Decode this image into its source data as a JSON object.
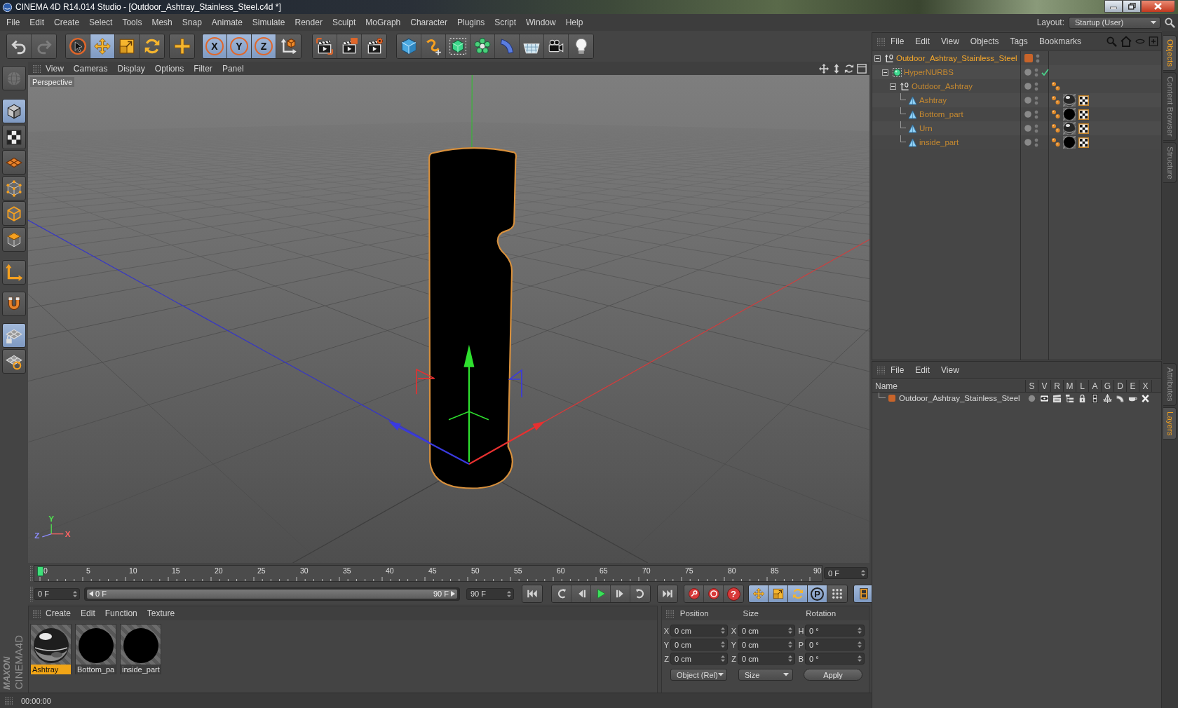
{
  "window": {
    "title": "CINEMA 4D R14.014 Studio - [Outdoor_Ashtray_Stainless_Steel.c4d *]"
  },
  "menu": [
    "File",
    "Edit",
    "Create",
    "Select",
    "Tools",
    "Mesh",
    "Snap",
    "Animate",
    "Simulate",
    "Render",
    "Sculpt",
    "MoGraph",
    "Character",
    "Plugins",
    "Script",
    "Window",
    "Help"
  ],
  "layout": {
    "label": "Layout:",
    "value": "Startup (User)"
  },
  "toolbar": {
    "groups": [
      {
        "buttons": [
          {
            "selected": false,
            "disabled": false
          },
          {
            "selected": false,
            "disabled": true
          }
        ]
      },
      {
        "buttons": [
          {
            "selected": false
          },
          {
            "selected": true
          },
          {
            "selected": false
          },
          {
            "selected": false
          }
        ]
      },
      {
        "buttons": [
          {
            "selected": false
          }
        ]
      },
      {
        "buttons": [
          {
            "label": "X",
            "selected": true
          },
          {
            "label": "Y",
            "selected": true
          },
          {
            "label": "Z",
            "selected": true
          },
          {
            "selected": false
          }
        ]
      },
      {
        "buttons": [
          {
            "selected": false
          },
          {
            "selected": false
          },
          {
            "selected": false
          }
        ]
      },
      {
        "buttons": [
          {
            "selected": false
          },
          {
            "selected": false
          },
          {
            "selected": false
          },
          {
            "selected": false
          },
          {
            "selected": false
          },
          {
            "selected": false
          },
          {
            "selected": false
          },
          {
            "selected": false
          }
        ]
      }
    ]
  },
  "left_tools": [
    {
      "selected": false,
      "disabled": true
    },
    {
      "selected": true,
      "disabled": false
    },
    {
      "selected": false,
      "disabled": false
    },
    {
      "selected": false,
      "disabled": false
    },
    {
      "selected": false,
      "disabled": false
    },
    {
      "selected": false,
      "disabled": false
    },
    {
      "selected": false,
      "disabled": false
    },
    {
      "selected": false,
      "disabled": false
    },
    {
      "selected": false,
      "disabled": false
    },
    {
      "selected": true,
      "disabled": false
    },
    {
      "selected": false,
      "disabled": false
    }
  ],
  "viewport": {
    "menu": [
      "View",
      "Cameras",
      "Display",
      "Options",
      "Filter",
      "Panel"
    ],
    "camera": "Perspective",
    "axis_indicator": [
      {
        "label": "Y",
        "color": "#50e050"
      },
      {
        "label": "Z",
        "color": "#8c8cff"
      },
      {
        "label": "X",
        "color": "#ff6464"
      }
    ]
  },
  "timeline": {
    "ticks": [
      "0",
      "5",
      "10",
      "15",
      "20",
      "25",
      "30",
      "35",
      "40",
      "45",
      "50",
      "55",
      "60",
      "65",
      "70",
      "75",
      "80",
      "85",
      "90"
    ],
    "level": 0,
    "frame": "0 F"
  },
  "transport": {
    "start": "0 F",
    "range": {
      "start": "0 F",
      "end": "90 F",
      "level": 1
    },
    "end": "90 F",
    "groups": [
      {
        "buttons": [
          {
            "selected": false
          }
        ]
      },
      {
        "buttons": [
          {
            "selected": false
          },
          {
            "selected": false
          },
          {
            "selected": false
          },
          {
            "selected": false
          },
          {
            "selected": false
          }
        ]
      },
      {
        "buttons": [
          {
            "selected": false
          }
        ]
      },
      {
        "buttons": [
          {
            "selected": false
          },
          {
            "selected": false
          },
          {
            "label": "?",
            "selected": false
          }
        ]
      },
      {
        "buttons": [
          {
            "selected": true
          },
          {
            "selected": true
          },
          {
            "selected": true
          },
          {
            "label": "P",
            "selected": true
          },
          {
            "selected": false
          }
        ]
      },
      {
        "buttons": [
          {
            "selected": true
          }
        ]
      }
    ]
  },
  "materials": {
    "menu": [
      "Create",
      "Edit",
      "Function",
      "Texture"
    ],
    "items": [
      {
        "name": "Ashtray",
        "kind": "chrome",
        "selected": true
      },
      {
        "name": "Bottom_pa",
        "kind": "dark",
        "selected": false
      },
      {
        "name": "inside_part",
        "kind": "dark",
        "selected": false
      }
    ]
  },
  "coordinates": {
    "headers": [
      "Position",
      "Size",
      "Rotation"
    ],
    "rows": [
      {
        "position_axis": "X",
        "position": "0 cm",
        "size_axis": "X",
        "size": "0 cm",
        "rotation_axis": "H",
        "rotation": "0 °"
      },
      {
        "position_axis": "Y",
        "position": "0 cm",
        "size_axis": "Y",
        "size": "0 cm",
        "rotation_axis": "P",
        "rotation": "0 °"
      },
      {
        "position_axis": "Z",
        "position": "0 cm",
        "size_axis": "Z",
        "size": "0 cm",
        "rotation_axis": "B",
        "rotation": "0 °"
      }
    ],
    "mode": "Object (Rel)",
    "size_mode": "Size",
    "apply": "Apply"
  },
  "status_bar": {
    "time": "00:00:00"
  },
  "logo": {
    "brand": "MAXON",
    "product": "CINEMA4D"
  },
  "objects": {
    "menu": [
      "File",
      "Edit",
      "View",
      "Objects",
      "Tags",
      "Bookmarks"
    ],
    "tree": [
      {
        "name": "Outdoor_Ashtray_Stainless_Steel",
        "kind": "null",
        "selected": true,
        "expanded": true,
        "color": "#c8642a",
        "children": [
          {
            "name": "HyperNURBS",
            "kind": "nurbs",
            "selected": false,
            "expanded": true,
            "enabled": true,
            "children": [
              {
                "name": "Outdoor_Ashtray",
                "kind": "null",
                "selected": false,
                "expanded": true,
                "tags": [
                  {
                    "kind": "phong"
                  }
                ],
                "children": [
                  {
                    "name": "Ashtray",
                    "kind": "polygon",
                    "selected": false,
                    "tags": [
                      {
                        "kind": "phong"
                      },
                      {
                        "kind": "chrome"
                      },
                      {
                        "kind": "texture"
                      }
                    ]
                  },
                  {
                    "name": "Bottom_part",
                    "kind": "polygon",
                    "selected": false,
                    "tags": [
                      {
                        "kind": "phong"
                      },
                      {
                        "kind": "dark"
                      },
                      {
                        "kind": "texture"
                      }
                    ]
                  },
                  {
                    "name": "Urn",
                    "kind": "polygon",
                    "selected": false,
                    "tags": [
                      {
                        "kind": "phong"
                      },
                      {
                        "kind": "chrome"
                      },
                      {
                        "kind": "texture"
                      }
                    ]
                  },
                  {
                    "name": "inside_part",
                    "kind": "polygon",
                    "selected": false,
                    "tags": [
                      {
                        "kind": "phong"
                      },
                      {
                        "kind": "dark"
                      },
                      {
                        "kind": "texture"
                      }
                    ]
                  }
                ]
              }
            ]
          }
        ]
      }
    ]
  },
  "side_tabs": {
    "top": [
      {
        "label": "Objects",
        "selected": true
      },
      {
        "label": "Content Browser",
        "selected": false
      },
      {
        "label": "Structure",
        "selected": false
      }
    ],
    "bottom": [
      {
        "label": "Attributes",
        "selected": false
      },
      {
        "label": "Layers",
        "selected": true
      }
    ]
  },
  "layers": {
    "menu": [
      "File",
      "Edit",
      "View"
    ],
    "columns": [
      "Name",
      "S",
      "V",
      "R",
      "M",
      "L",
      "A",
      "G",
      "D",
      "E",
      "X"
    ],
    "rows": [
      {
        "name": "Outdoor_Ashtray_Stainless_Steel",
        "color": "#c8642a"
      }
    ]
  }
}
